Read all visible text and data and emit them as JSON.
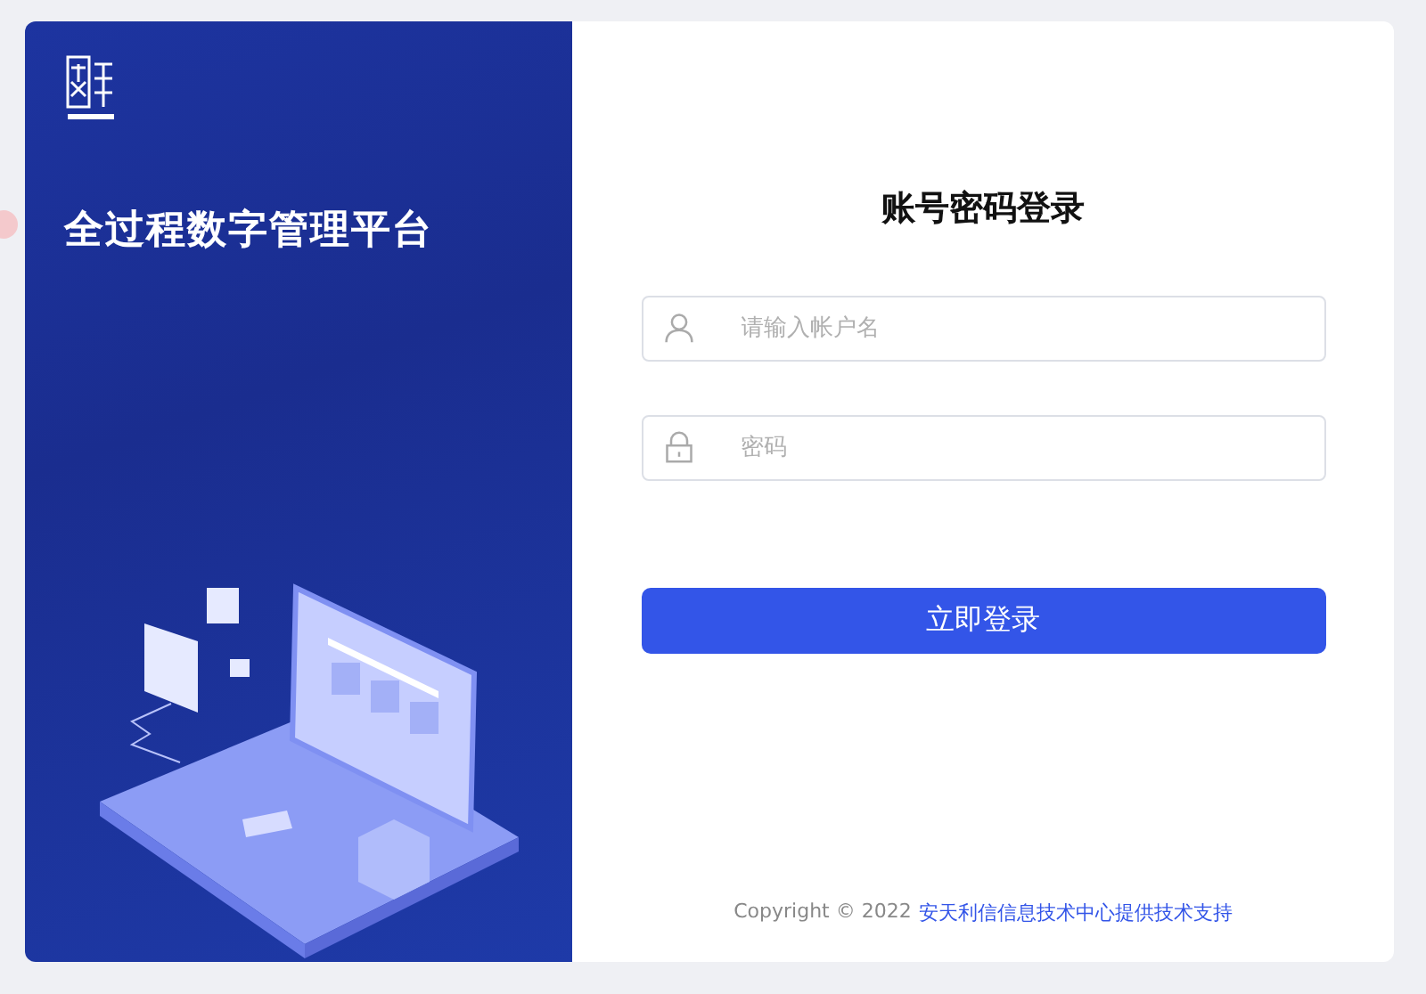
{
  "brand": {
    "slogan": "全过程数字管理平台"
  },
  "login": {
    "title": "账号密码登录",
    "fields": [
      {
        "kind": "user",
        "placeholder": "请输入帐户名"
      },
      {
        "kind": "password",
        "placeholder": "密码"
      }
    ],
    "submit": "立即登录"
  },
  "footer": {
    "copyright": "Copyright © 2022",
    "provider": "安天利信信息技术中心提供技术支持"
  }
}
